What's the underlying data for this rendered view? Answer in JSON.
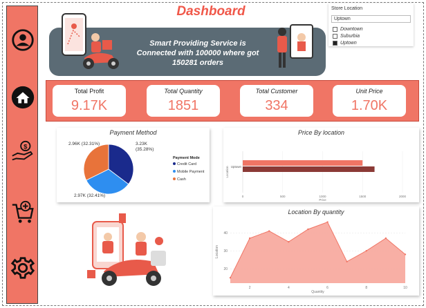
{
  "header": {
    "title": "Dashboard"
  },
  "banner": {
    "line1": "Smart Providing Service is",
    "line2": "Connected with 100000 where got",
    "line3": "150281 orders"
  },
  "store_slicer": {
    "title": "Store Location",
    "selected": "Uptown",
    "options": [
      {
        "label": "Downtown",
        "checked": false
      },
      {
        "label": "Suburbia",
        "checked": false
      },
      {
        "label": "Uptown",
        "checked": true
      }
    ]
  },
  "sidebar": {
    "items": [
      {
        "icon": "user-profile-icon"
      },
      {
        "icon": "home-icon"
      },
      {
        "icon": "money-hand-icon"
      },
      {
        "icon": "add-to-cart-icon"
      },
      {
        "icon": "settings-gear-icon"
      }
    ]
  },
  "kpis": [
    {
      "label": "Total Profit",
      "value": "9.17K"
    },
    {
      "label": "Total Quantity",
      "value": "1851"
    },
    {
      "label": "Total Customer",
      "value": "334"
    },
    {
      "label": "Unit Price",
      "value": "1.70K"
    }
  ],
  "colors": {
    "accent": "#f07565",
    "title": "#f0584a",
    "banner": "#5b6b75",
    "credit_card": "#1a2a8c",
    "mobile_payment": "#2e8ef0",
    "cash": "#e8733a",
    "bar_light": "#f07565",
    "bar_dark": "#8b3a36",
    "area": "#f7a195"
  },
  "chart_data": [
    {
      "type": "pie",
      "title": "Payment Method",
      "legend_title": "Payment Mode",
      "legend_placement": "right",
      "slices": [
        {
          "name": "Credit Card",
          "value": 3230,
          "label": "3.23K (35.28%)",
          "percent": 35.28
        },
        {
          "name": "Mobile Payment",
          "value": 2970,
          "label": "2.97K (32.41%)",
          "percent": 32.41
        },
        {
          "name": "Cash",
          "value": 2960,
          "label": "2.96K (32.31%)",
          "percent": 32.31
        }
      ]
    },
    {
      "type": "bar",
      "orientation": "horizontal",
      "title": "Price By location",
      "xlabel": "Price",
      "ylabel": "Location",
      "categories": [
        "Uptown"
      ],
      "series": [
        {
          "values": [
            1500
          ]
        },
        {
          "values": [
            1650
          ]
        }
      ],
      "xticks": [
        "0",
        "500",
        "1000",
        "1500",
        "2000"
      ],
      "xlim": [
        0,
        2000
      ]
    },
    {
      "type": "area",
      "title": "Location By quantity",
      "xlabel": "Quantity",
      "ylabel": "Location",
      "x": [
        1,
        2,
        3,
        4,
        5,
        6,
        7,
        8,
        9,
        10
      ],
      "y": [
        15,
        37,
        41,
        35,
        42,
        46,
        24,
        30,
        37,
        28
      ],
      "xticks": [
        2,
        4,
        6,
        8,
        10
      ],
      "yticks": [
        20,
        30,
        40
      ],
      "xlim": [
        1,
        10
      ],
      "ylim": [
        12,
        47
      ]
    }
  ]
}
